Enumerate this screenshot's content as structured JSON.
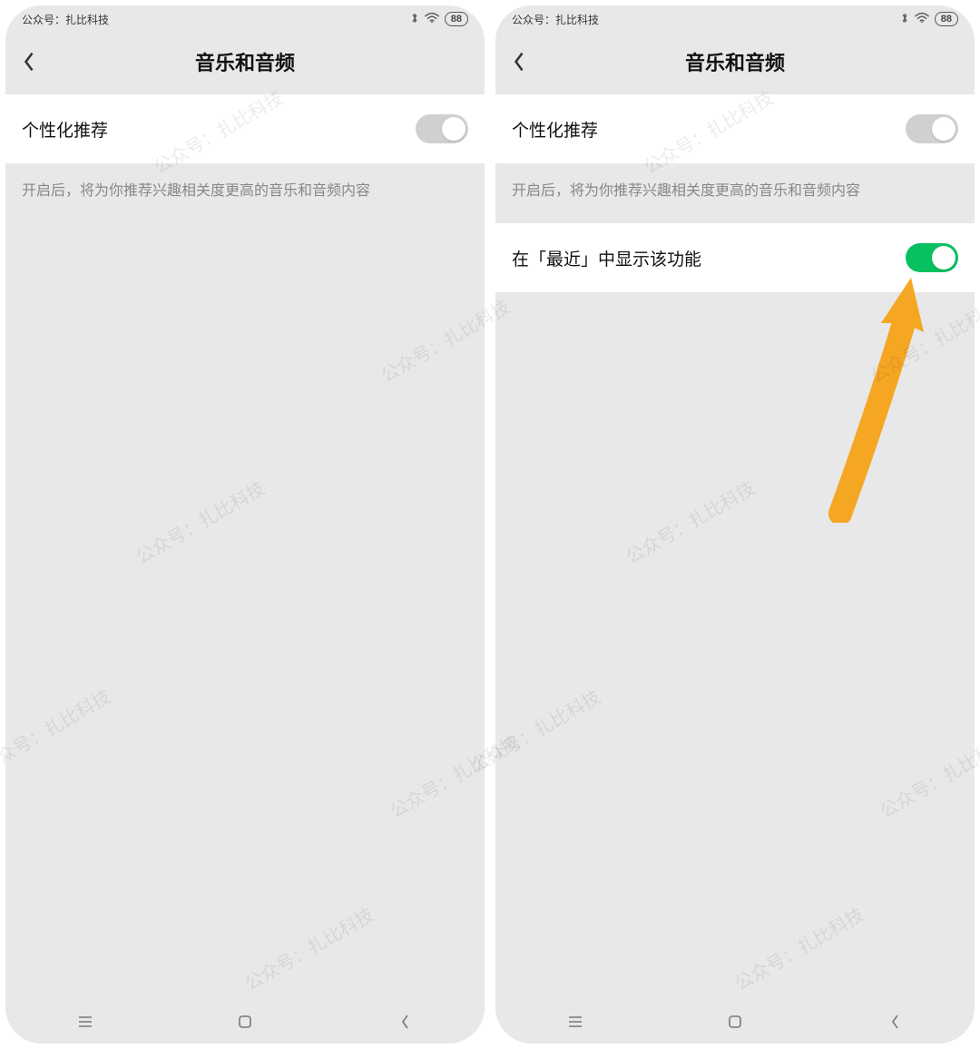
{
  "watermark_text": "公众号：扎比科技",
  "status": {
    "source_label": "公众号：扎比科技",
    "battery": "88"
  },
  "page_title": "音乐和音频",
  "settings": {
    "personalization": {
      "label": "个性化推荐",
      "description": "开启后，将为你推荐兴趣相关度更高的音乐和音频内容",
      "enabled": false
    },
    "show_in_recent": {
      "label": "在「最近」中显示该功能",
      "enabled": true
    }
  },
  "colors": {
    "toggle_on": "#07c160",
    "toggle_off": "#d0d0d0",
    "arrow": "#f5a623"
  }
}
